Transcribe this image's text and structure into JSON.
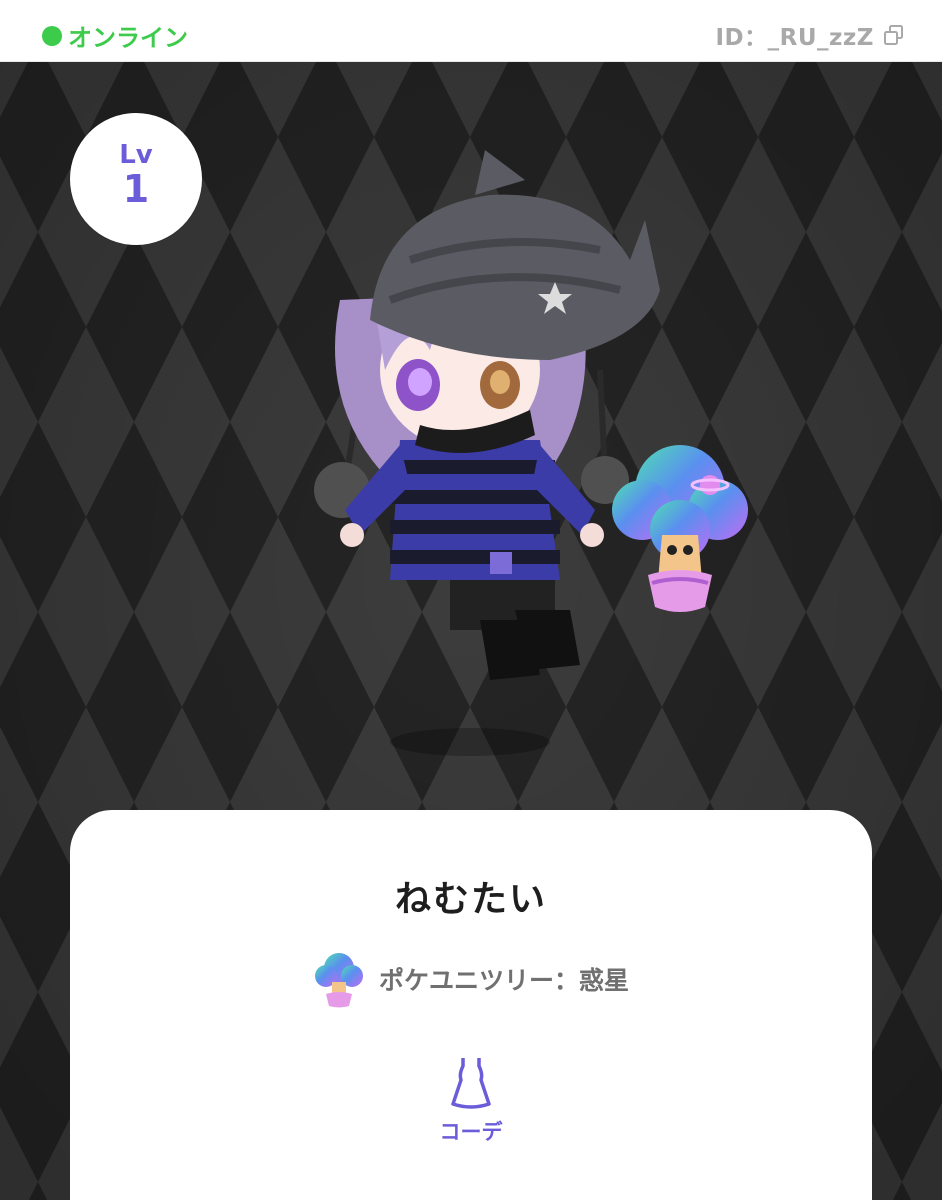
{
  "status": {
    "online_label": "オンライン",
    "online_color": "#3ccb4a",
    "user_id": "ID：_RU_zzZ"
  },
  "profile": {
    "level_label": "Lv",
    "level_value": "1",
    "nickname": "ねむたい"
  },
  "item": {
    "label": "ポケユニツリー：惑星",
    "icon": "planet-tree-icon"
  },
  "coord": {
    "label": "コーデ",
    "icon": "dress-icon"
  },
  "colors": {
    "accent": "#6b5cd9",
    "bg_dark": "#3a3a3a",
    "bg_diamond": "#2a2a2a"
  }
}
